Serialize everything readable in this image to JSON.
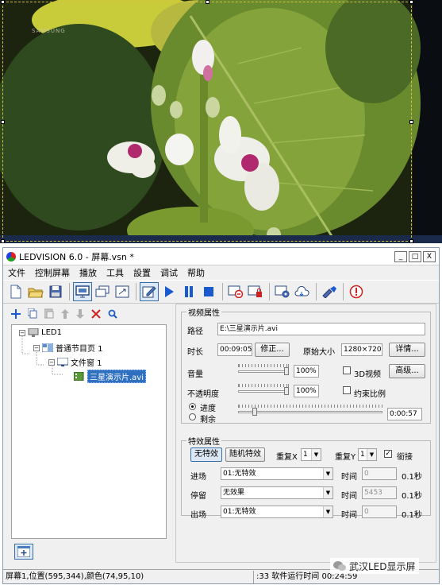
{
  "preview": {
    "watermark_brand": "SAMSUNG"
  },
  "window": {
    "title": "LEDVISION 6.0 - 屏幕.vsn *",
    "buttons": {
      "minimize": "_",
      "maximize": "□",
      "close": "X"
    }
  },
  "menu": [
    "文件",
    "控制屏幕",
    "播放",
    "工具",
    "設置",
    "调试",
    "帮助"
  ],
  "toolbar_icons": [
    "new-file-icon",
    "open-folder-icon",
    "save-icon",
    "screen-display-icon",
    "multi-screen-icon",
    "fit-screen-icon",
    "edit-icon",
    "play-icon",
    "pause-icon",
    "stop-icon",
    "delete-screen-icon",
    "lock-screen-icon",
    "settings-icon",
    "cloud-icon",
    "send-icon",
    "info-icon"
  ],
  "tree": {
    "root": "LED1",
    "page": "普通节目页 1",
    "window": "文件窗 1",
    "file": "三星演示片.avi"
  },
  "video_props": {
    "legend": "视频属性",
    "path_label": "路径",
    "path_value": "E:\\三星演示片.avi",
    "duration_label": "时长",
    "duration_value": "00:09:05",
    "modify_button": "修正...",
    "orig_size_label": "原始大小",
    "orig_size_value": "1280×720",
    "details_button": "详情...",
    "volume_label": "音量",
    "volume_value": "100%",
    "volume_level_pct": 100,
    "video3d_label": "3D视频",
    "video3d_checked": false,
    "advanced_button": "高级...",
    "opacity_label": "不透明度",
    "opacity_value": "100%",
    "opacity_level_pct": 100,
    "ratio_label": "约束比例",
    "ratio_checked": false,
    "progress_label": "进度",
    "remain_label": "剩余",
    "progress_time": "0:00:57"
  },
  "effect_props": {
    "legend": "特效属性",
    "no_effect_button": "无特效",
    "random_button": "随机特效",
    "repeat_x_label": "重复X",
    "repeat_x_value": "1",
    "repeat_y_label": "重复Y",
    "repeat_y_value": "1",
    "join_label": "銜接",
    "join_checked": true,
    "rows": [
      {
        "label": "进场",
        "value": "01:无特效",
        "time_label": "时间",
        "time_value": "0",
        "unit": "0.1秒"
      },
      {
        "label": "停留",
        "value": "无效果",
        "time_label": "时间",
        "time_value": "5453",
        "unit": "0.1秒"
      },
      {
        "label": "出场",
        "value": "01:无特效",
        "time_label": "时间",
        "time_value": "0",
        "unit": "0.1秒"
      }
    ]
  },
  "status": {
    "left": "屏幕1,位置(595,344),颜色(74,95,10)",
    "right": ":33 软件运行时间 00:24:59"
  },
  "overlay_watermark": "武汉LED显示屏"
}
